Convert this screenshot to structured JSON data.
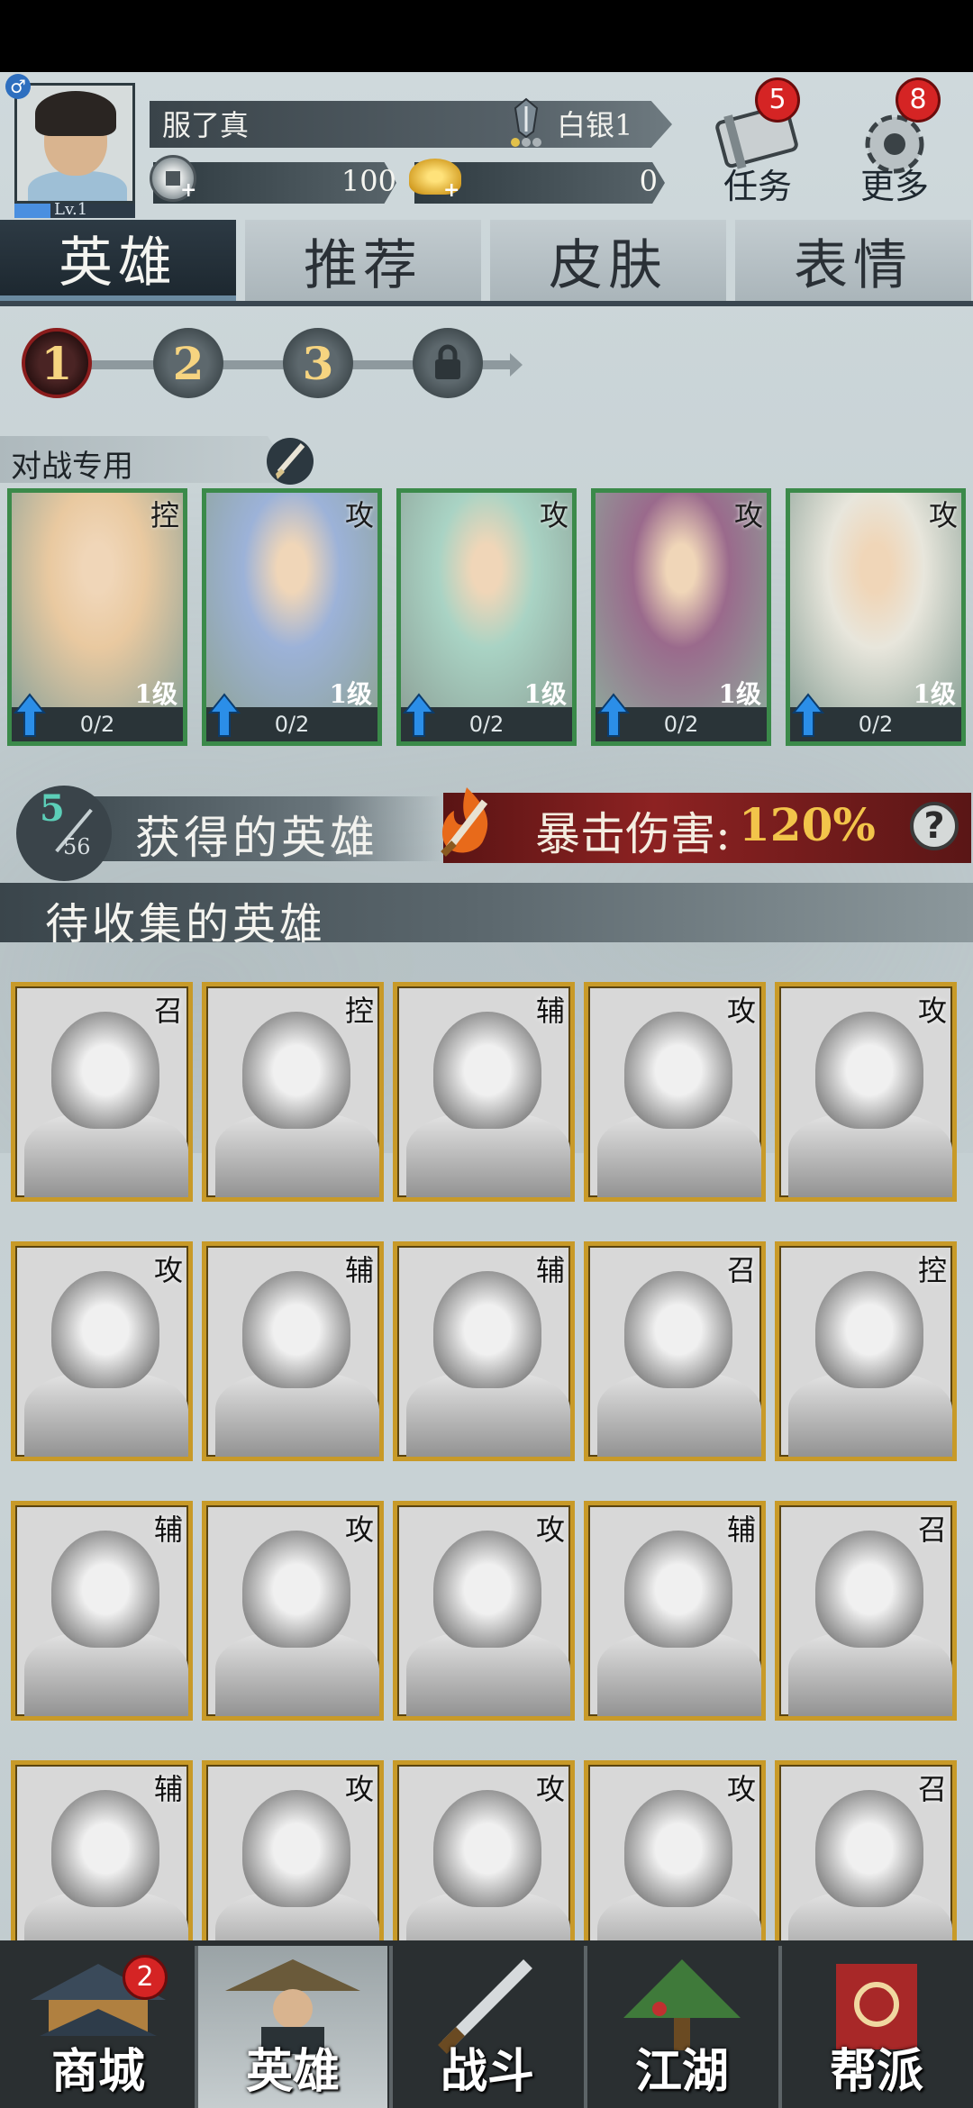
{
  "player": {
    "name": "服了真",
    "level": "Lv.1",
    "gender_symbol": "♂",
    "rank": "白银1",
    "silver": "100",
    "gold": "0"
  },
  "top_buttons": {
    "tasks": {
      "label": "任务",
      "badge": "5"
    },
    "more": {
      "label": "更多",
      "badge": "8"
    }
  },
  "tabs": [
    "英雄",
    "推荐",
    "皮肤",
    "表情"
  ],
  "pages": [
    "1",
    "2",
    "3"
  ],
  "team": {
    "label": "对战专用",
    "heroes": [
      {
        "role": "控",
        "level": "1级",
        "progress": "0/2",
        "color": "#e9c9a0"
      },
      {
        "role": "攻",
        "level": "1级",
        "progress": "0/2",
        "color": "#9cb2d8"
      },
      {
        "role": "攻",
        "level": "1级",
        "progress": "0/2",
        "color": "#a9d3c4"
      },
      {
        "role": "攻",
        "level": "1级",
        "progress": "0/2",
        "color": "#9a6a8c"
      },
      {
        "role": "攻",
        "level": "1级",
        "progress": "0/2",
        "color": "#e8e6dc"
      }
    ]
  },
  "obtained": {
    "count": "5",
    "total": "56",
    "label": "获得的英雄",
    "crit_label": "暴击伤害:",
    "crit_value": "120%",
    "help": "?"
  },
  "to_collect": {
    "label": "待收集的英雄",
    "roles": [
      "召",
      "控",
      "辅",
      "攻",
      "攻",
      "攻",
      "辅",
      "辅",
      "召",
      "控",
      "辅",
      "攻",
      "攻",
      "辅",
      "召",
      "辅",
      "攻",
      "攻",
      "攻",
      "召"
    ]
  },
  "nav": {
    "items": [
      {
        "label": "商城",
        "badge": "2"
      },
      {
        "label": "英雄"
      },
      {
        "label": "战斗"
      },
      {
        "label": "江湖"
      },
      {
        "label": "帮派"
      }
    ]
  },
  "colors": {
    "accent_red": "#d52424",
    "gold_border": "#c89a28",
    "green_border": "#3b8a4a",
    "crit_gold": "#f2c44a"
  }
}
